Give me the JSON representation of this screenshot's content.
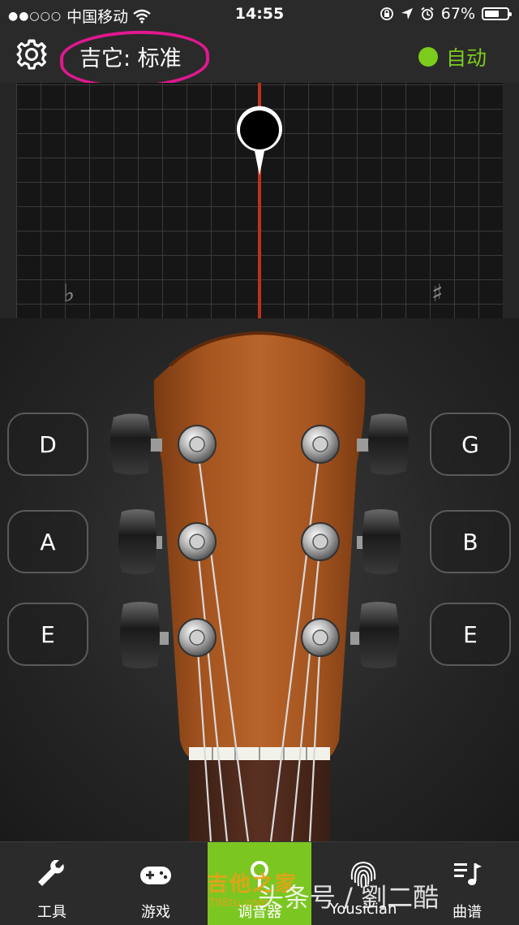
{
  "status_bar": {
    "carrier": "中国移动",
    "time": "14:55",
    "battery_percent": "67%",
    "battery_level": 0.67,
    "signal_dots": "●●○○○"
  },
  "header": {
    "title": "吉它: 标准",
    "mode_label": "自动",
    "mode_color": "#7ccc1e",
    "annotation_color": "#e0188f"
  },
  "tuner": {
    "flat_symbol": "♭",
    "sharp_symbol": "♯",
    "needle_color": "#b8331d"
  },
  "strings": {
    "left": [
      "D",
      "A",
      "E"
    ],
    "right": [
      "G",
      "B",
      "E"
    ]
  },
  "tabs": [
    {
      "label": "工具",
      "icon": "wrench-icon"
    },
    {
      "label": "游戏",
      "icon": "gamepad-icon"
    },
    {
      "label": "调音器",
      "icon": "tuner-pin-icon",
      "active": true
    },
    {
      "label": "Yousician",
      "icon": "fingerprint-icon"
    },
    {
      "label": "曲谱",
      "icon": "music-notes-icon"
    }
  ],
  "watermarks": {
    "site_name": "吉他之家",
    "site_url": "798tu.com",
    "toutiao": "头条号 / 劉二酷"
  }
}
